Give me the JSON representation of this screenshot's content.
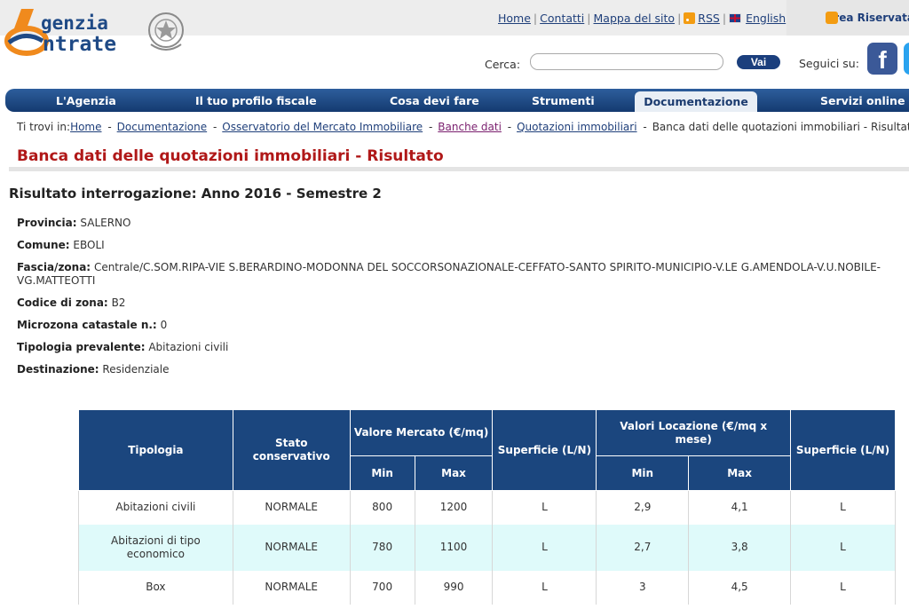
{
  "header": {
    "logo_line1": "genzia",
    "logo_line2": "ntrate",
    "links": {
      "home": "Home",
      "contatti": "Contatti",
      "mappa": "Mappa del sito",
      "rss": "RSS",
      "english": "English"
    },
    "area_riservata": "Area Riservata",
    "search_label": "Cerca:",
    "search_value": "",
    "search_button": "Vai",
    "seguici": "Seguici su:",
    "facebook": "f"
  },
  "nav": {
    "items": [
      "L'Agenzia",
      "Il tuo profilo fiscale",
      "Cosa devi fare",
      "Strumenti",
      "Documentazione",
      "Servizi online"
    ]
  },
  "breadcrumb": {
    "prefix": "Ti trovi in:",
    "items": [
      "Home",
      "Documentazione",
      "Osservatorio del Mercato Immobiliare",
      "Banche dati",
      "Quotazioni immobiliari"
    ],
    "current": "Banca dati delle quotazioni immobiliari - Risultato"
  },
  "page_title": "Banca dati delle quotazioni immobiliari - Risultato",
  "subtitle": "Risultato interrogazione: Anno 2016 - Semestre 2",
  "details": [
    {
      "label": "Provincia:",
      "value": "SALERNO"
    },
    {
      "label": "Comune:",
      "value": "EBOLI"
    },
    {
      "label": "Fascia/zona:",
      "value": "Centrale/C.SOM.RIPA-VIE S.BERARDINO-MODONNA DEL SOCCORSONAZIONALE-CEFFATO-SANTO SPIRITO-MUNICIPIO-V.LE G.AMENDOLA-V.U.NOBILE-VG.MATTEOTTI"
    },
    {
      "label": "Codice di zona:",
      "value": "B2"
    },
    {
      "label": "Microzona catastale n.:",
      "value": "0"
    },
    {
      "label": "Tipologia prevalente:",
      "value": "Abitazioni civili"
    },
    {
      "label": "Destinazione:",
      "value": "Residenziale"
    }
  ],
  "table": {
    "headers": {
      "tipologia": "Tipologia",
      "stato": "Stato conservativo",
      "valore_mercato": "Valore Mercato (€/mq)",
      "superficie": "Superficie (L/N)",
      "valori_locazione": "Valori Locazione (€/mq x mese)",
      "min": "Min",
      "max": "Max"
    },
    "rows": [
      {
        "tipologia": "Abitazioni civili",
        "stato": "NORMALE",
        "vm_min": "800",
        "vm_max": "1200",
        "sup1": "L",
        "vl_min": "2,9",
        "vl_max": "4,1",
        "sup2": "L"
      },
      {
        "tipologia": "Abitazioni di tipo economico",
        "stato": "NORMALE",
        "vm_min": "780",
        "vm_max": "1100",
        "sup1": "L",
        "vl_min": "2,7",
        "vl_max": "3,8",
        "sup2": "L"
      },
      {
        "tipologia": "Box",
        "stato": "NORMALE",
        "vm_min": "700",
        "vm_max": "990",
        "sup1": "L",
        "vl_min": "3",
        "vl_max": "4,5",
        "sup2": "L"
      }
    ]
  },
  "colors": {
    "nav_blue": "#1b467e",
    "title_red": "#b01818",
    "row_alt": "#dffafa"
  }
}
